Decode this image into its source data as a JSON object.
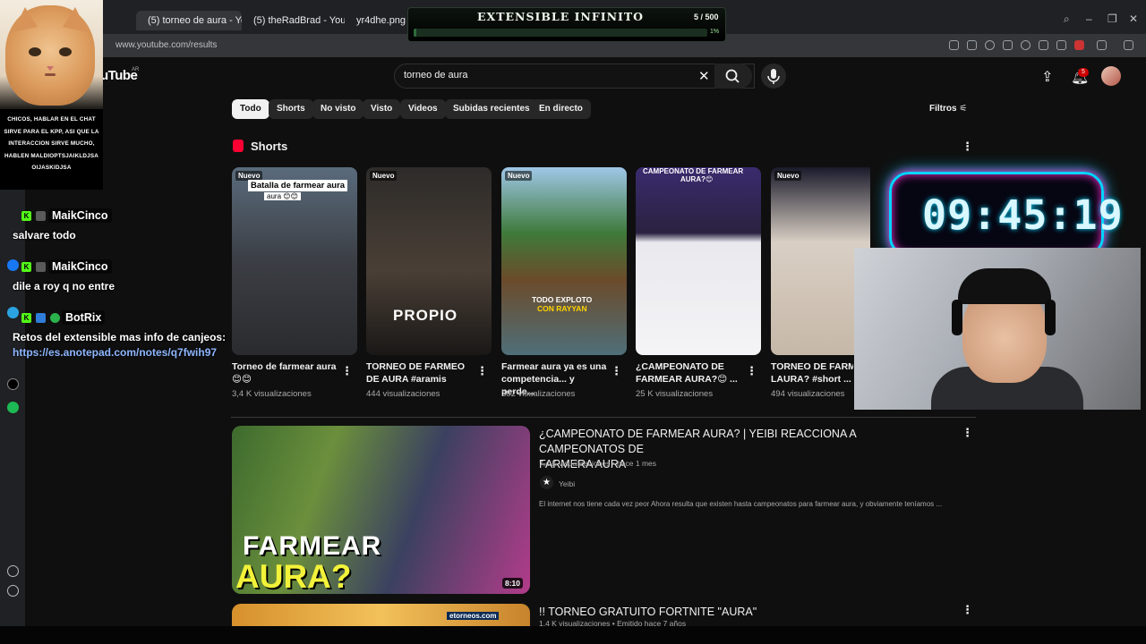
{
  "browser": {
    "tabs": [
      {
        "label": "(5) torneo de aura - YouTu",
        "active": true
      },
      {
        "label": "(5) theRadBrad - YouTube",
        "active": false
      },
      {
        "label": "yr4dhe.png (95",
        "active": false
      }
    ],
    "url": "www.youtube.com/results"
  },
  "youtube": {
    "logo": "uTube",
    "country": "AR",
    "search_query": "torneo de aura",
    "notifications_count": "5",
    "chips": [
      "Todo",
      "Shorts",
      "No visto",
      "Visto",
      "Videos",
      "Subidas recientes",
      "En directo"
    ],
    "selected_chip": "Todo",
    "filters_label": "Filtros",
    "shorts_header": "Shorts",
    "shorts": [
      {
        "badge": "Nuevo",
        "overlay": "Batalla de farmear aura",
        "overlay_sub": "aura 😊😊",
        "title_1": "Torneo de farmear aura",
        "title_2": "😊😊",
        "views": "3,4 K visualizaciones"
      },
      {
        "badge": "Nuevo",
        "overlay": "PROPIO",
        "title_1": "TORNEO DE FARMEO",
        "title_2": "DE AURA #aramis",
        "views": "444 visualizaciones"
      },
      {
        "badge": "Nuevo",
        "overlay": "TODO EXPLOTO",
        "overlay_sub": "CON RAYYAN",
        "title_1": "Farmear aura ya es una",
        "title_2": "competencia... y perde...",
        "views": "382 visualizaciones"
      },
      {
        "badge": "",
        "overlay": "CAMPEONATO DE FARMEAR",
        "overlay_sub": "AURA?😊",
        "title_1": "¿CAMPEONATO DE",
        "title_2": "FARMEAR AURA?😊 ...",
        "views": "25 K visualizaciones"
      },
      {
        "badge": "Nuevo",
        "overlay": "",
        "title_1": "TORNEO DE FARME",
        "title_2": "LAURA? #short ...",
        "views": "494 visualizaciones"
      }
    ],
    "videos": [
      {
        "title_1": "¿CAMPEONATO DE FARMEAR AURA? | YEIBI REACCIONA A CAMPEONATOS DE",
        "title_2": "FARMERA AURA",
        "meta": "7,4 K visualizaciones • hace 1 mes",
        "channel": "Yeibi",
        "description": "El internet nos tiene cada vez peor Ahora resulta que existen hasta campeonatos para farmear aura, y obviamente teníamos ...",
        "thumb_line1": "FARMEAR",
        "thumb_line2": "AURA?",
        "duration": "8:10"
      },
      {
        "title_1": "!! TORNEO GRATUITO FORTNITE \"AURA\"",
        "meta": "1,4 K visualizaciones • Emitido hace 7 años",
        "thumb_logo": "etorneos.com"
      }
    ]
  },
  "overlays": {
    "cat_caption": "CHICOS, HABLAR EN EL CHAT SIRVE PARA EL KPP, ASI QUE LA INTERACCION SIRVE MUCHO, HABLEN MALDIOPTSJAIKLDJSA OIJASKIDJSA",
    "extensible": {
      "title": "EXTENSIBLE INFINITO",
      "count": "5 / 500",
      "percent_label": "1%",
      "progress": 0.01
    },
    "chat": [
      {
        "name": "MaikCinco",
        "message": "salvare todo"
      },
      {
        "name": "MaikCinco",
        "message": "dile a roy q no entre"
      },
      {
        "name": "BotRix",
        "message": "Retos del extensible mas info de canjeos:",
        "link": "https://es.anotepad.com/notes/q7fwih97"
      }
    ],
    "clock": "09:45:19"
  },
  "colors": {
    "yt_red": "#ff0033",
    "kick_green": "#53fc18",
    "clock_cyan": "#00d5ff",
    "clock_pink": "#ff2bd6"
  }
}
